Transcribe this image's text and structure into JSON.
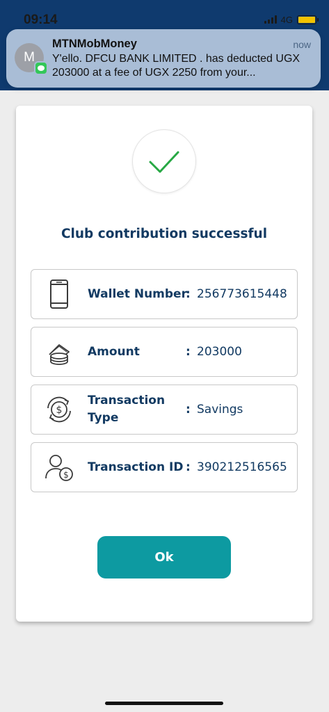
{
  "status_bar": {
    "time": "09:14",
    "network": "4G",
    "battery_color": "#f2c200"
  },
  "notification": {
    "app_name": "MTNMobMoney",
    "avatar_letter": "M",
    "time": "now",
    "body": "Y'ello. DFCU BANK LIMITED . has deducted UGX 203000 at a fee of UGX 2250 from your...",
    "badge_icon": "messages-icon"
  },
  "card": {
    "status_icon": "checkmark-icon",
    "title": "Club contribution successful",
    "rows": [
      {
        "icon": "phone-icon",
        "label": "Wallet Number",
        "value": "256773615448"
      },
      {
        "icon": "coins-icon",
        "label": "Amount",
        "value": "203000"
      },
      {
        "icon": "currency-exchange-icon",
        "label": "Transaction Type",
        "value": "Savings"
      },
      {
        "icon": "user-money-icon",
        "label": "Transaction ID",
        "value": "390212516565"
      }
    ],
    "separator": ":",
    "ok_label": "Ok"
  },
  "colors": {
    "header_blue": "#0f3a6e",
    "text_navy": "#123a62",
    "button_teal": "#0d9aa1",
    "check_green": "#27a844"
  }
}
